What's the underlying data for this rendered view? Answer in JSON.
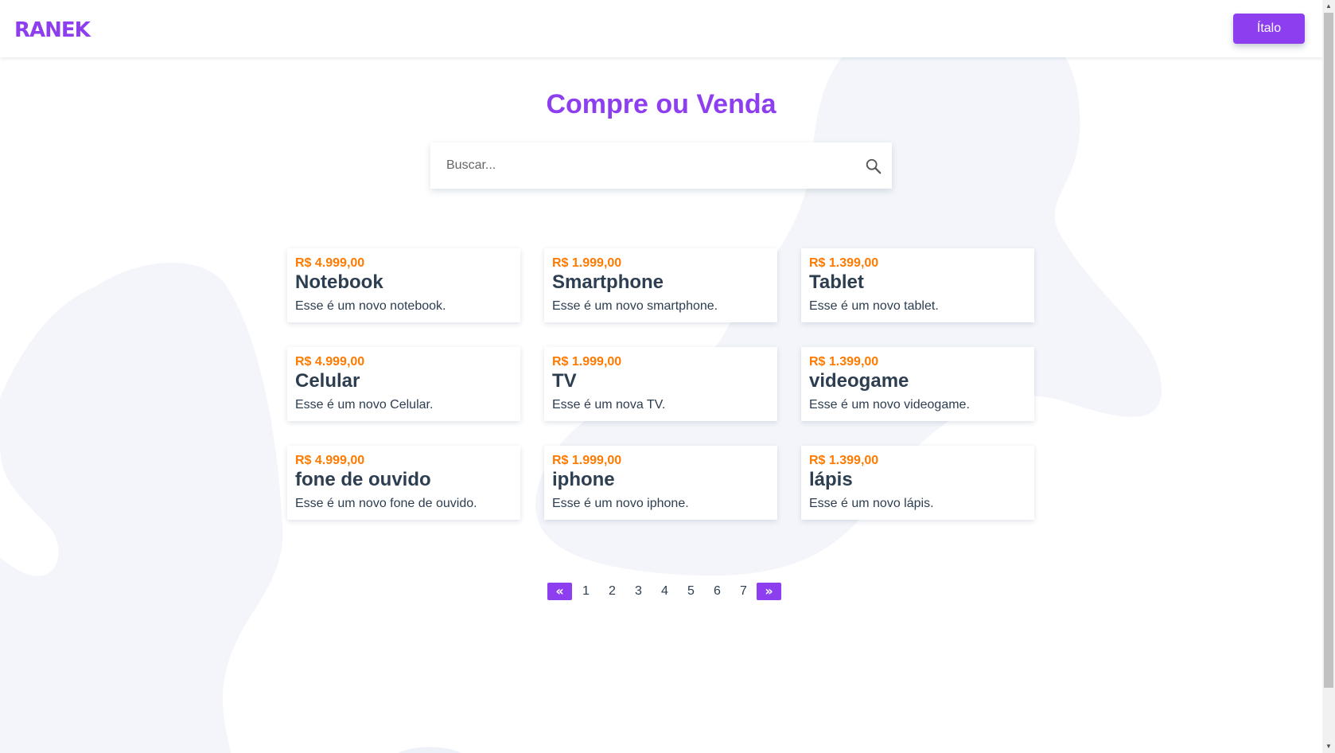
{
  "header": {
    "logo_text": "RANEK",
    "user_button_label": "Ítalo"
  },
  "main": {
    "title": "Compre ou Venda",
    "search": {
      "placeholder": "Buscar...",
      "value": ""
    }
  },
  "products": [
    {
      "price": "R$ 4.999,00",
      "name": "Notebook",
      "description": "Esse é um novo notebook."
    },
    {
      "price": "R$ 1.999,00",
      "name": "Smartphone",
      "description": "Esse é um novo smartphone."
    },
    {
      "price": "R$ 1.399,00",
      "name": "Tablet",
      "description": "Esse é um novo tablet."
    },
    {
      "price": "R$ 4.999,00",
      "name": "Celular",
      "description": "Esse é um novo Celular."
    },
    {
      "price": "R$ 1.999,00",
      "name": "TV",
      "description": "Esse é um nova TV."
    },
    {
      "price": "R$ 1.399,00",
      "name": "videogame",
      "description": "Esse é um novo videogame."
    },
    {
      "price": "R$ 4.999,00",
      "name": "fone de ouvido",
      "description": "Esse é um novo fone de ouvido."
    },
    {
      "price": "R$ 1.999,00",
      "name": "iphone",
      "description": "Esse é um novo iphone."
    },
    {
      "price": "R$ 1.399,00",
      "name": "lápis",
      "description": "Esse é um novo lápis."
    }
  ],
  "pagination": {
    "prev_icon": "double-chevron-left-icon",
    "next_icon": "double-chevron-right-icon",
    "pages": [
      "1",
      "2",
      "3",
      "4",
      "5",
      "6",
      "7"
    ]
  },
  "colors": {
    "brand": "#8d3ff0",
    "price": "#ff7a00",
    "text": "#2c3e50",
    "blob": "#f3f5fa"
  }
}
